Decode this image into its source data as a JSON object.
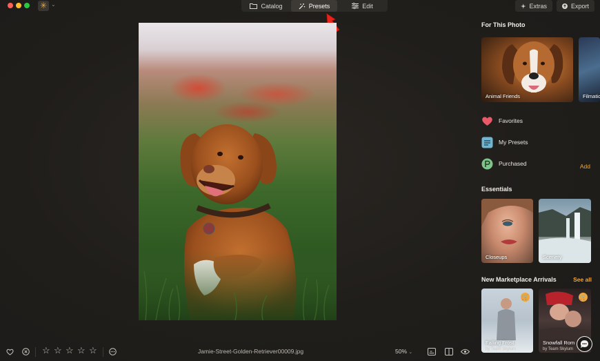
{
  "app": {
    "icon": "sun-burst-icon",
    "accent": "#f0a63a"
  },
  "tabs": [
    {
      "label": "Catalog",
      "icon": "folder-icon"
    },
    {
      "label": "Presets",
      "icon": "magic-wand-icon",
      "active": true
    },
    {
      "label": "Edit",
      "icon": "sliders-icon"
    }
  ],
  "toolbar": {
    "extras_label": "Extras",
    "export_label": "Export"
  },
  "panel": {
    "for_this_photo": {
      "title": "For This Photo",
      "cards": [
        {
          "label": "Animal Friends"
        },
        {
          "label": "Filmatic"
        }
      ]
    },
    "collections": [
      {
        "label": "Favorites",
        "icon": "heart-icon"
      },
      {
        "label": "My Presets",
        "icon": "presets-icon"
      },
      {
        "label": "Purchased",
        "icon": "purchased-icon",
        "action": "Add"
      }
    ],
    "essentials": {
      "title": "Essentials",
      "cards": [
        {
          "label": "Closeups"
        },
        {
          "label": "Scenery"
        }
      ]
    },
    "marketplace": {
      "title": "New Marketplace Arrivals",
      "see_all": "See all",
      "cards": [
        {
          "label": "Falling Frost",
          "author": "by Team Skylum"
        },
        {
          "label": "Snowfall Rom",
          "author": "by Team Skylum"
        }
      ]
    }
  },
  "bottom": {
    "filename": "Jamie-Street-Golden-Retriever00009.jpg",
    "zoom": "50%",
    "rating_stars": 5,
    "rating_value": 0
  }
}
